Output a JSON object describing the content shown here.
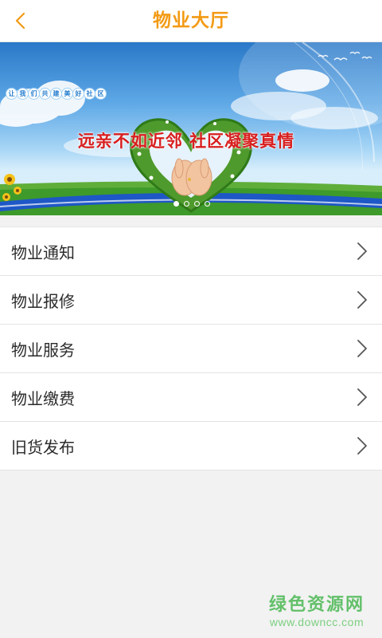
{
  "header": {
    "title": "物业大厅",
    "back_icon": "chevron-left-icon",
    "accent_color": "#f39a14"
  },
  "banner": {
    "slogan": "远亲不如近邻  社区凝聚真情",
    "tagline_chars": [
      "让",
      "我",
      "们",
      "共",
      "建",
      "美",
      "好",
      "社",
      "区"
    ],
    "active_slide": 1,
    "slide_count": 4
  },
  "menu": {
    "items": [
      {
        "label": "物业通知",
        "icon": "chevron-right-icon"
      },
      {
        "label": "物业报修",
        "icon": "chevron-right-icon"
      },
      {
        "label": "物业服务",
        "icon": "chevron-right-icon"
      },
      {
        "label": "物业缴费",
        "icon": "chevron-right-icon"
      },
      {
        "label": "旧货发布",
        "icon": "chevron-right-icon"
      }
    ]
  },
  "watermark": {
    "title": "绿色资源网",
    "url": "www.downcc.com",
    "color": "#63c06a"
  }
}
